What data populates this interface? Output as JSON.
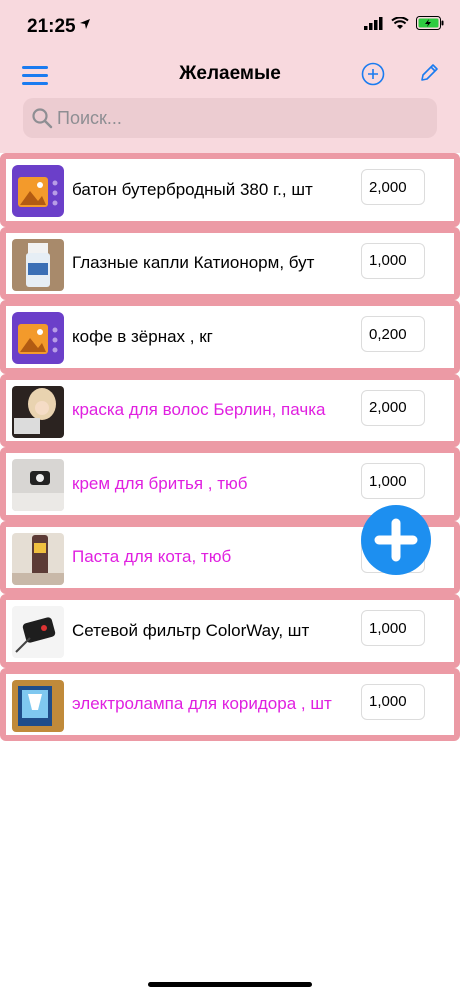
{
  "status_bar": {
    "time": "21:25"
  },
  "nav": {
    "title": "Желаемые"
  },
  "search": {
    "placeholder": "Поиск..."
  },
  "colors": {
    "accent": "#1a7bf0",
    "header_bg": "#f8d9de",
    "row_border": "#ec9aa5",
    "highlight_text": "#e020e0"
  },
  "items": [
    {
      "name": "батон бутербродный 380 г., шт",
      "qty": "2,000",
      "highlight": false,
      "thumb": "placeholder-icon"
    },
    {
      "name": "Глазные капли Катионорм, бут",
      "qty": "1,000",
      "highlight": false,
      "thumb": "eye-drops-photo"
    },
    {
      "name": "кофе в зёрнах , кг",
      "qty": "0,200",
      "highlight": false,
      "thumb": "placeholder-icon"
    },
    {
      "name": "краска для волос Берлин, пачка",
      "qty": "2,000",
      "highlight": true,
      "thumb": "hair-dye-photo"
    },
    {
      "name": "крем для бритья , тюб",
      "qty": "1,000",
      "highlight": true,
      "thumb": "shaving-cream-photo"
    },
    {
      "name": "Паста для кота, тюб",
      "qty": "",
      "highlight": true,
      "thumb": "cat-paste-photo"
    },
    {
      "name": "Сетевой фильтр ColorWay, шт",
      "qty": "1,000",
      "highlight": false,
      "thumb": "power-filter-photo"
    },
    {
      "name": "электролампа для коридора , шт",
      "qty": "1,000",
      "highlight": true,
      "thumb": "lamp-photo"
    }
  ]
}
